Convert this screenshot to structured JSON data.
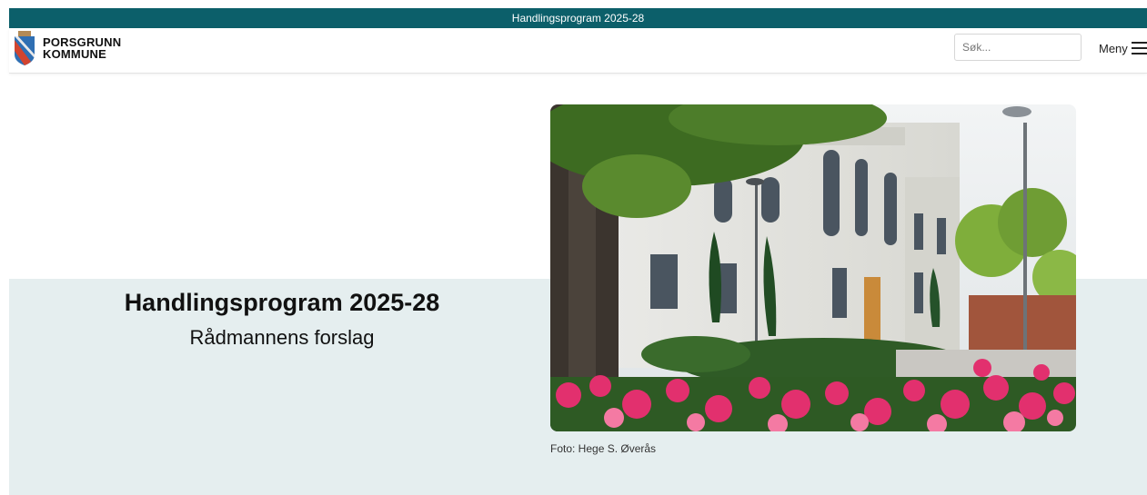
{
  "topbar": {
    "title": "Handlingsprogram 2025-28"
  },
  "header": {
    "logo_line1": "PORSGRUNN",
    "logo_line2": "KOMMUNE",
    "search_placeholder": "Søk...",
    "menu_label": "Meny"
  },
  "hero": {
    "title": "Handlingsprogram 2025-28",
    "subtitle": "Rådmannens forslag",
    "photo_caption": "Foto: Hege S. Øverås"
  },
  "colors": {
    "topbar": "#0c5f6a",
    "band": "#e5eeef"
  }
}
